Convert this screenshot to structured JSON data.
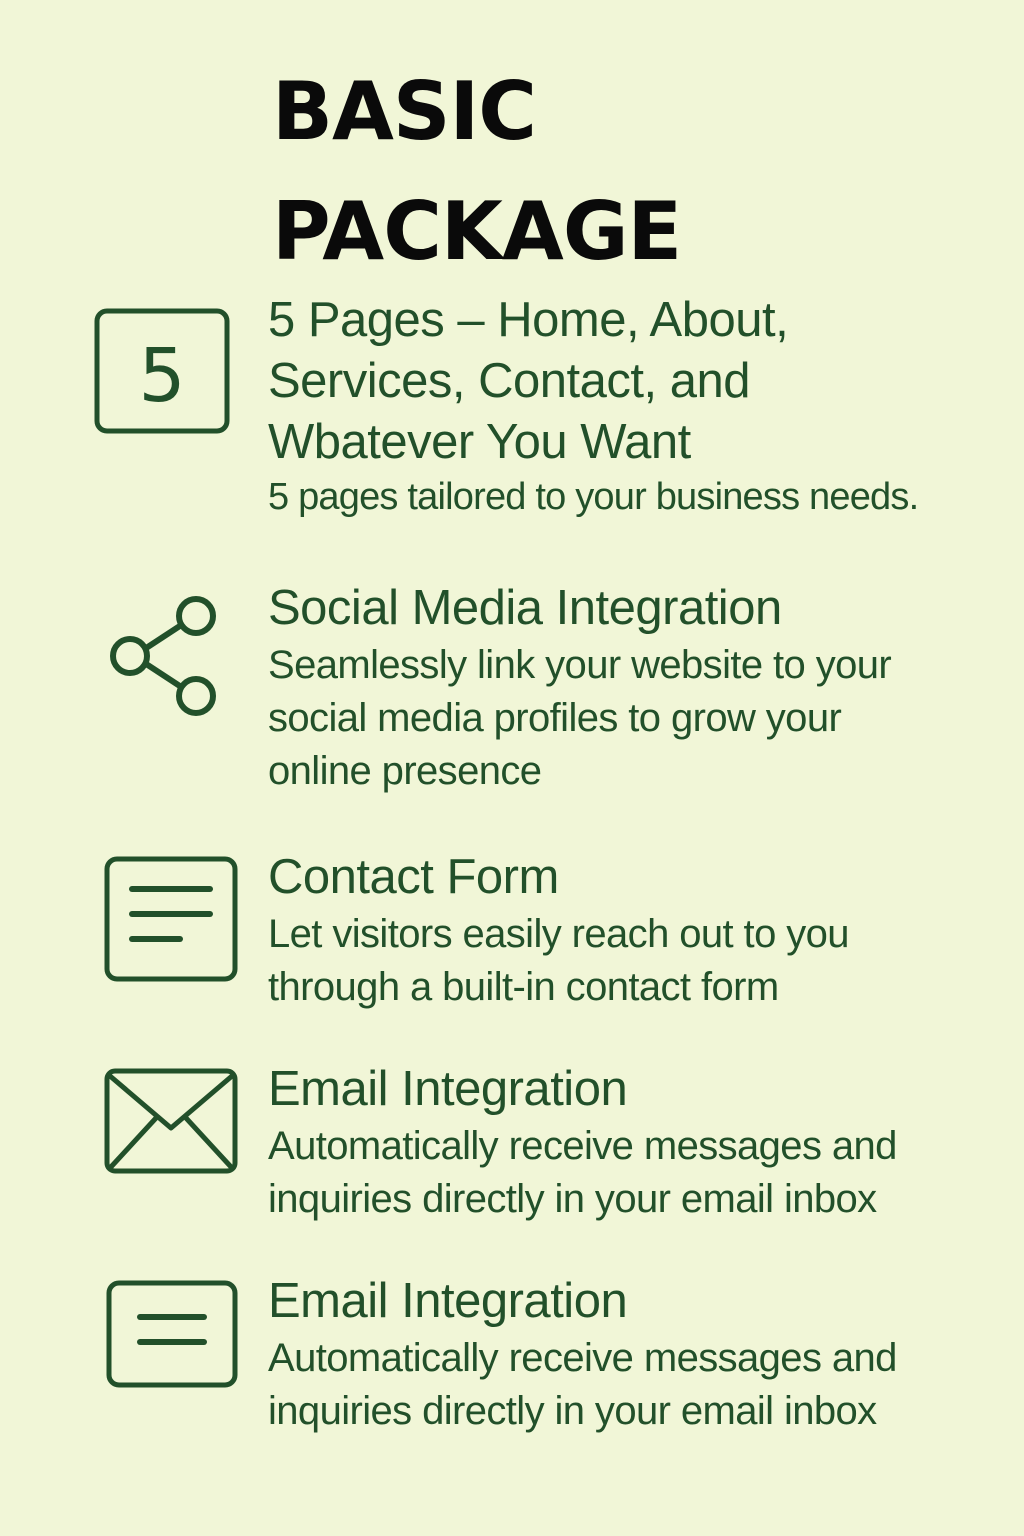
{
  "title": {
    "line1": "BASIC",
    "line2": "PACKAGE"
  },
  "theme": {
    "background": "#f1f6d7",
    "text_color": "#22502a",
    "title_color": "#0a0a0a"
  },
  "features": [
    {
      "icon": "number-five-icon",
      "icon_text": "5",
      "heading_lines": [
        "5 Pages – Home, About,",
        "Services, Contact, and",
        "Wbatever You Want"
      ],
      "description_lines": [
        "5 pages tailored to your business needs."
      ]
    },
    {
      "icon": "share-icon",
      "heading_lines": [
        "Social Media Integration"
      ],
      "description_lines": [
        "Seamlessly link your website to your",
        "social media profiles to grow your",
        "online presence"
      ]
    },
    {
      "icon": "form-icon",
      "heading_lines": [
        "Contact Form"
      ],
      "description_lines": [
        "Let visitors easily reach out to you",
        "through a built-in contact form"
      ]
    },
    {
      "icon": "envelope-icon",
      "heading_lines": [
        "Email Integration"
      ],
      "description_lines": [
        "Automatically receive messages and",
        "inquiries directly in your email inbox"
      ]
    },
    {
      "icon": "message-box-icon",
      "heading_lines": [
        "Email Integration"
      ],
      "description_lines": [
        "Automatically receive messages and",
        "inquiries directly in your email inbox"
      ]
    }
  ]
}
